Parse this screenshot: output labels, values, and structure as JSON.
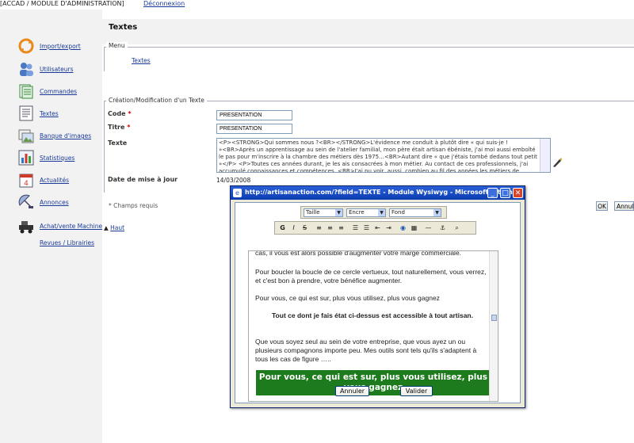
{
  "header": {
    "app_title": "[ACCAD / MODULE D'ADMINISTRATION]",
    "logout": "Déconnexion"
  },
  "sidebar": {
    "items": [
      {
        "label": "Import/export",
        "icon": "refresh-arrows-icon"
      },
      {
        "label": "Utilisateurs",
        "icon": "users-icon"
      },
      {
        "label": "Commandes",
        "icon": "orders-icon"
      },
      {
        "label": "Textes",
        "icon": "document-icon"
      },
      {
        "label": "Banque d'images",
        "icon": "images-icon"
      },
      {
        "label": "Statistiques",
        "icon": "chart-icon"
      },
      {
        "label": "Actualités",
        "icon": "calendar-icon"
      },
      {
        "label": "Annonces",
        "icon": "satellite-icon"
      },
      {
        "label": "Achat/vente Machines",
        "icon": "machine-icon"
      },
      {
        "label": "Revues / Librairies"
      }
    ]
  },
  "page": {
    "title": "Textes",
    "menu_legend": "Menu",
    "menu_link": "Textes",
    "form_legend": "Création/Modification d'un Texte",
    "code_label": "Code",
    "code_value": "PRESENTATION",
    "titre_label": "Titre",
    "titre_value": "PRESENTATION",
    "texte_label": "Texte",
    "texte_value": "<P><STRONG>Qui sommes nous ?<BR></STRONG>L'évidence me conduit à plutôt dire « qui suis-je ! »<BR>Après un apprentissage au sein de l'atelier familial, mon père était artisan ébéniste, j'ai moi aussi emboîté le pas pour m'inscrire à la chambre des métiers dès 1975…<BR>Autant dire « que j'étais tombé dedans tout petit »</P> <P>Toutes ces années durant, je les ais consacrées à mon métier. Au contact de ces professionnels, j'ai accumulé connaissances et compétences. <BR>J'ai pu voir, aussi, combien au fil des années les métiers de l'artisanat évoluaient, quelles étaient les",
    "date_label": "Date de mise à jour",
    "date_value": "14/03/2008",
    "required_note": "* Champs requis",
    "top_link": "Haut",
    "ok_button": "OK",
    "cancel_button": "Annuler",
    "required_mark": "*"
  },
  "popup": {
    "title": "http://artisanaction.com/?field=TEXTE - Module Wysiwyg - Microsoft Intern...",
    "font_size_select": "Taille",
    "ink_select": "Encre",
    "bg_select": "Fond",
    "toolbar": [
      "G",
      "I",
      "S"
    ],
    "editor": {
      "line_top": "cas, il vous est alors possible d'augmenter votre marge commerciale.",
      "para1": "Pour boucler la boucle de ce cercle vertueux, tout naturellement, vous verrez, et c'est bon à prendre, votre bénéfice augmenter.",
      "para2": "Pour vous, ce qui est sur, plus vous utilisez, plus vous gagnez",
      "para3": "Tout ce dont je fais état ci-dessus est accessible à tout artisan.",
      "para4": "Que vous soyez seul au sein de votre entreprise, que vous ayez un ou plusieurs compagnons importe peu. Mes outils sont tels qu'ils s'adaptent à tous les cas de figure …..",
      "highlight": "Pour vous, ce qui est sur, plus vous utilisez, plus vous gagnez"
    },
    "cancel_button": "Annuler",
    "validate_button": "Valider"
  }
}
